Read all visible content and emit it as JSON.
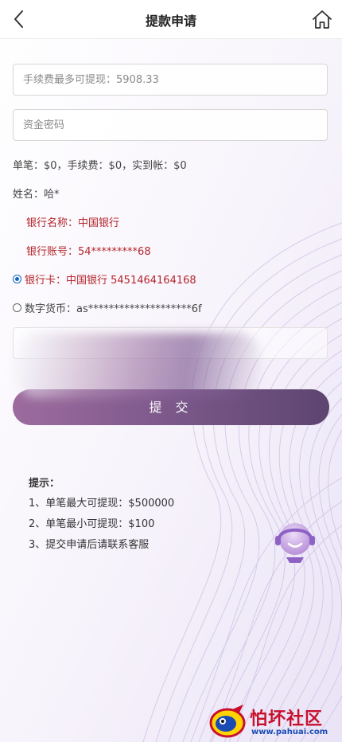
{
  "header": {
    "title": "提款申请"
  },
  "form": {
    "amount_placeholder": "手续费最多可提现：5908.33",
    "password_placeholder": "资金密码",
    "fee_summary": "单笔：$0，手续费：$0，实到帐：$0",
    "name": "姓名：哈*",
    "bank_name": "银行名称：中国银行",
    "bank_account": "银行账号：54*********68",
    "options": [
      {
        "label": "银行卡：中国银行 5451464164168",
        "checked": true
      },
      {
        "label": "数字货币：as********************6f",
        "checked": false
      }
    ],
    "submit_label": "提 交"
  },
  "tips": {
    "title": "提示：",
    "items": [
      "1、单笔最大可提现：$500000",
      "2、单笔最小可提现：$100",
      "3、提交申请后请联系客服"
    ]
  },
  "watermark": {
    "title": "怕坏社区",
    "url": "www.pahuai.com"
  },
  "colors": {
    "accent_start": "#9d6b9e",
    "accent_end": "#5d4570",
    "bank_text": "#b3262b",
    "radio_selected": "#1565c0"
  },
  "icons": {
    "back": "chevron-left-icon",
    "home": "home-icon",
    "support": "customer-service-headset-icon"
  }
}
